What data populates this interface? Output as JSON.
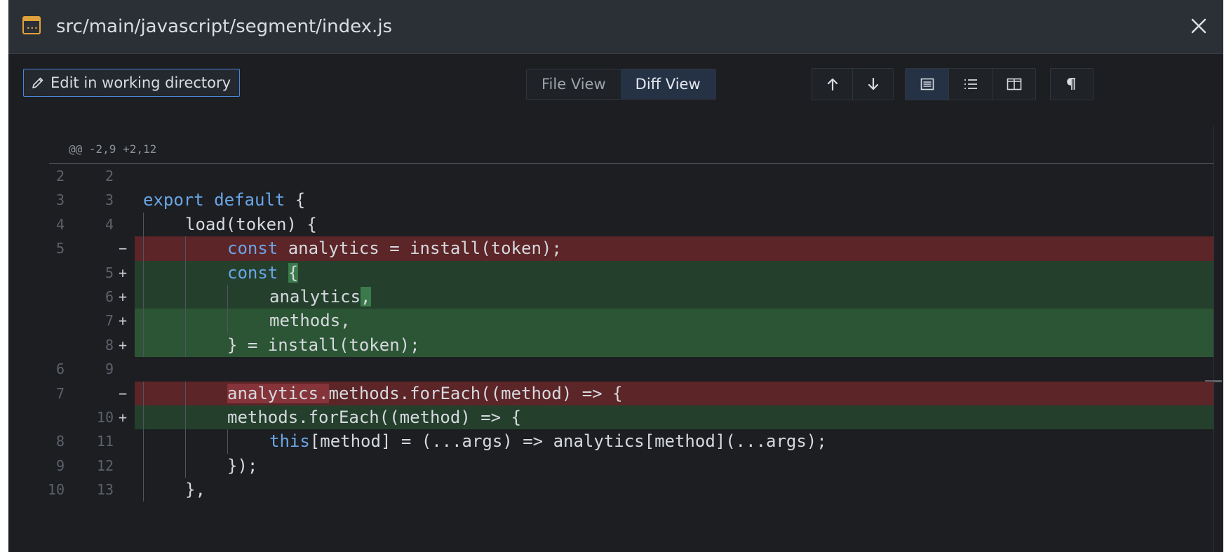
{
  "window": {
    "title": "src/main/javascript/segment/index.js"
  },
  "toolbar": {
    "edit_label": "Edit in working directory",
    "view_tabs": [
      {
        "label": "File View",
        "active": false
      },
      {
        "label": "Diff View",
        "active": true
      }
    ],
    "nav_icons": [
      "arrow-up-icon",
      "arrow-down-icon"
    ],
    "layout_icons": [
      "unified-view-icon",
      "list-view-icon",
      "split-view-icon"
    ],
    "whitespace_icon": "pilcrow-icon"
  },
  "diff": {
    "hunk_header": "@@ -2,9 +2,12",
    "lines": [
      {
        "old": "2",
        "new": "2",
        "type": "ctx",
        "indent": 0,
        "code": ""
      },
      {
        "old": "3",
        "new": "3",
        "type": "ctx",
        "indent": 0,
        "code": "export default {"
      },
      {
        "old": "4",
        "new": "4",
        "type": "ctx",
        "indent": 1,
        "code": "load(token) {"
      },
      {
        "old": "5",
        "new": "",
        "type": "del",
        "indent": 2,
        "code": "const analytics = install(token);"
      },
      {
        "old": "",
        "new": "5",
        "type": "add",
        "indent": 2,
        "code": "const {"
      },
      {
        "old": "",
        "new": "6",
        "type": "add",
        "indent": 3,
        "code": "analytics,"
      },
      {
        "old": "",
        "new": "7",
        "type": "add",
        "indent": 3,
        "code": "methods,"
      },
      {
        "old": "",
        "new": "8",
        "type": "add",
        "indent": 2,
        "code": "} = install(token);"
      },
      {
        "old": "6",
        "new": "9",
        "type": "ctx",
        "indent": 0,
        "code": ""
      },
      {
        "old": "7",
        "new": "",
        "type": "del",
        "indent": 2,
        "code": "analytics.methods.forEach((method) => {"
      },
      {
        "old": "",
        "new": "10",
        "type": "add",
        "indent": 2,
        "code": "methods.forEach((method) => {"
      },
      {
        "old": "8",
        "new": "11",
        "type": "ctx",
        "indent": 3,
        "code": "this[method] = (...args) => analytics[method](...args);"
      },
      {
        "old": "9",
        "new": "12",
        "type": "ctx",
        "indent": 2,
        "code": "});"
      },
      {
        "old": "10",
        "new": "13",
        "type": "ctx",
        "indent": 1,
        "code": "},"
      }
    ]
  },
  "colors": {
    "accent": "#4a86d8",
    "deleted": "#5c2528",
    "added": "#24402d",
    "keyword": "#6aa6e6"
  }
}
